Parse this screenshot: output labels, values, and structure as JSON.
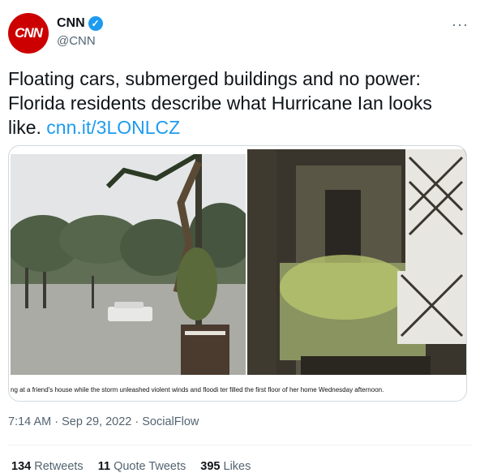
{
  "author": {
    "avatar_text": "CNN",
    "display_name": "CNN",
    "handle": "@CNN",
    "verified_glyph": "✓",
    "more_glyph": "···"
  },
  "tweet": {
    "text": "Floating cars, submerged buildings and no power: Florida residents describe what Hurricane Ian looks like. ",
    "link": "cnn.it/3LONLCZ"
  },
  "media": {
    "caption": "ng at a friend's house while the storm unleashed violent winds and floodi ter filled the first floor of her home Wednesday afternoon.",
    "left_photo": "flooded-street-photo",
    "right_photo": "flooded-hallway-photo"
  },
  "meta": {
    "time": "7:14 AM",
    "date": "Sep 29, 2022",
    "source": "SocialFlow"
  },
  "stats": {
    "retweets_count": "134",
    "retweets_label": "Retweets",
    "quotes_count": "11",
    "quotes_label": "Quote Tweets",
    "likes_count": "395",
    "likes_label": "Likes"
  },
  "colors": {
    "brand_red": "#cc0000",
    "link_blue": "#1d9bf0",
    "muted": "#536471"
  }
}
